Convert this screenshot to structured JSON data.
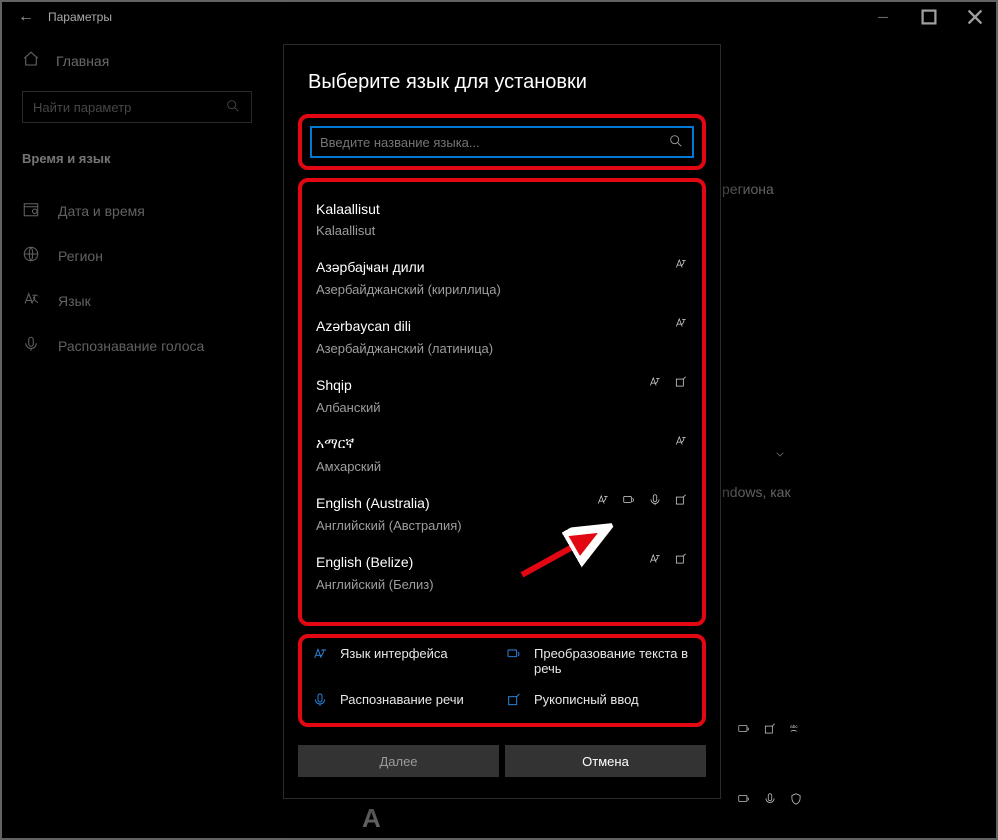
{
  "window": {
    "title": "Параметры",
    "home": "Главная",
    "search_placeholder": "Найти параметр",
    "group": "Время и язык"
  },
  "sidebar": {
    "items": [
      {
        "label": "Дата и время"
      },
      {
        "label": "Регион"
      },
      {
        "label": "Язык"
      },
      {
        "label": "Распознавание голоса"
      }
    ]
  },
  "background": {
    "hint1": "региона",
    "hint2": "ndows, как"
  },
  "dialog": {
    "title": "Выберите язык для установки",
    "search_placeholder": "Введите название языка...",
    "languages": [
      {
        "name": "Kalaallisut",
        "sub": "Kalaallisut",
        "icons": []
      },
      {
        "name": "Азәрбајҹан дили",
        "sub": "Азербайджанский (кириллица)",
        "icons": [
          "display"
        ]
      },
      {
        "name": "Azərbaycan dili",
        "sub": "Азербайджанский (латиница)",
        "icons": [
          "display"
        ]
      },
      {
        "name": "Shqip",
        "sub": "Албанский",
        "icons": [
          "display",
          "hand"
        ]
      },
      {
        "name": "አማርኛ",
        "sub": "Амхарский",
        "icons": [
          "display"
        ]
      },
      {
        "name": "English (Australia)",
        "sub": "Английский (Австралия)",
        "icons": [
          "display",
          "tts",
          "mic",
          "hand"
        ]
      },
      {
        "name": "English (Belize)",
        "sub": "Английский (Белиз)",
        "icons": [
          "display",
          "hand"
        ]
      }
    ],
    "legend": {
      "display": "Язык интерфейса",
      "tts": "Преобразование текста в речь",
      "mic": "Распознавание речи",
      "hand": "Рукописный ввод"
    },
    "next": "Далее",
    "cancel": "Отмена"
  }
}
